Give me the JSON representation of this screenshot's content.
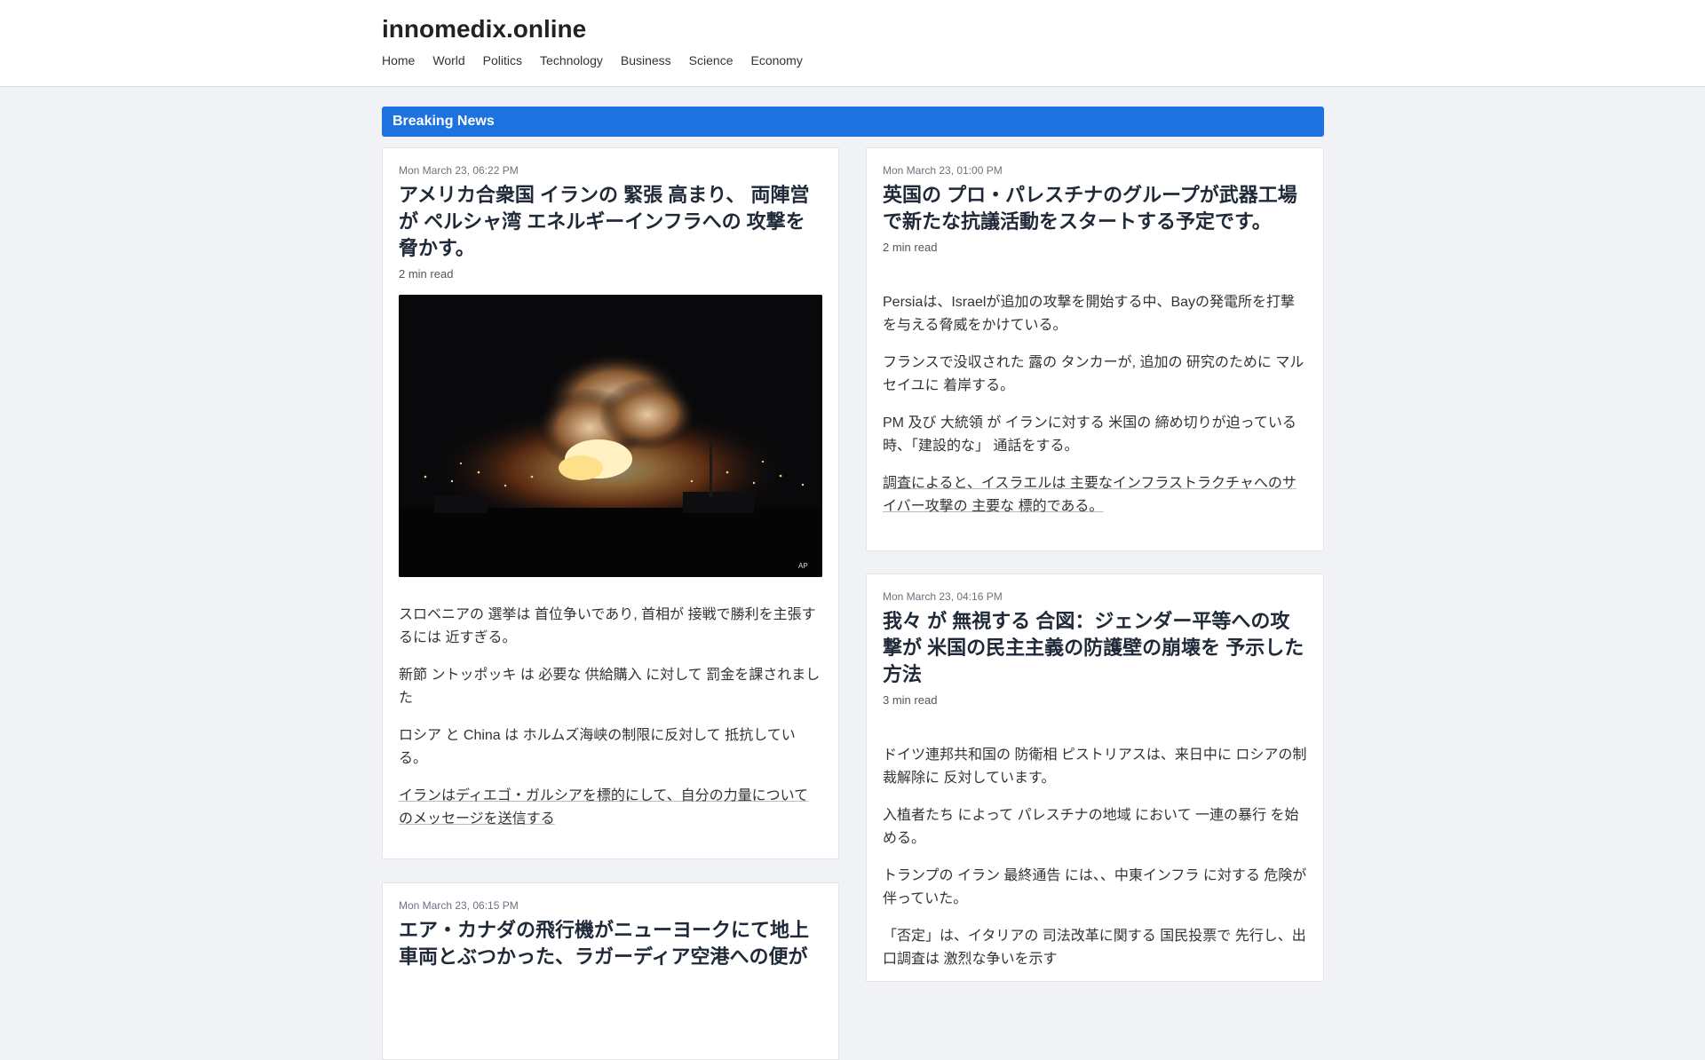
{
  "site": {
    "title": "innomedix.online",
    "nav": [
      "Home",
      "World",
      "Politics",
      "Technology",
      "Business",
      "Science",
      "Economy"
    ]
  },
  "breaking": {
    "label": "Breaking News"
  },
  "articles": [
    {
      "date": "Mon March 23, 06:22 PM",
      "headline": "アメリカ合衆国 イランの 緊張 高まり、 両陣営 が ペルシャ湾 エネルギーインフラへの 攻撃を 脅かす。",
      "read": "2 min read",
      "image_credit": "AP",
      "related": [
        "スロベニアの 選挙は 首位争いであり, 首相が 接戦で勝利を主張するには 近すぎる。",
        "新節 ントッポッキ は 必要な 供給購入 に対して 罰金を課されました",
        "ロシア と China は ホルムズ海峡の制限に反対して 抵抗している。",
        "イランはディエゴ・ガルシアを標的にして、自分の力量についてのメッセージを送信する"
      ]
    },
    {
      "date": "Mon March 23, 01:00 PM",
      "headline": "英国の プロ・パレスチナのグループが武器工場で新たな抗議活動をスタートする予定です。",
      "read": "2 min read",
      "related": [
        "Persiaは、Israelが追加の攻撃を開始する中、Bayの発電所を打撃を与える脅威をかけている。",
        "フランスで没収された 露の タンカーが, 追加の 研究のために マルセイユに 着岸する。",
        "PM 及び 大統領 が イランに対する 米国の 締め切りが迫っている時、「建設的な」 通話をする。",
        "調査によると、イスラエルは 主要なインフラストラクチャへのサイバー攻撃の 主要な 標的である。"
      ]
    },
    {
      "date": "Mon March 23, 04:16 PM",
      "headline": "我々 が 無視する 合図：ジェンダー平等への攻撃が 米国の民主主義の防護壁の崩壊を 予示した方法",
      "read": "3 min read",
      "related": [
        "ドイツ連邦共和国の 防衛相 ピストリアスは、来日中に ロシアの制裁解除に 反対しています。",
        "入植者たち によって パレスチナの地域 において 一連の暴行 を始める。",
        "トランプの イラン 最終通告 には、、中東インフラ に対する 危険が伴っていた。",
        "「否定」は、イタリアの 司法改革に関する 国民投票で 先行し、出口調査は 激烈な争いを示す"
      ]
    },
    {
      "date": "Mon March 23, 06:15 PM",
      "headline": "エア・カナダの飛行機がニューヨークにて地上車両とぶつかった、ラガーディア空港への便が"
    }
  ]
}
